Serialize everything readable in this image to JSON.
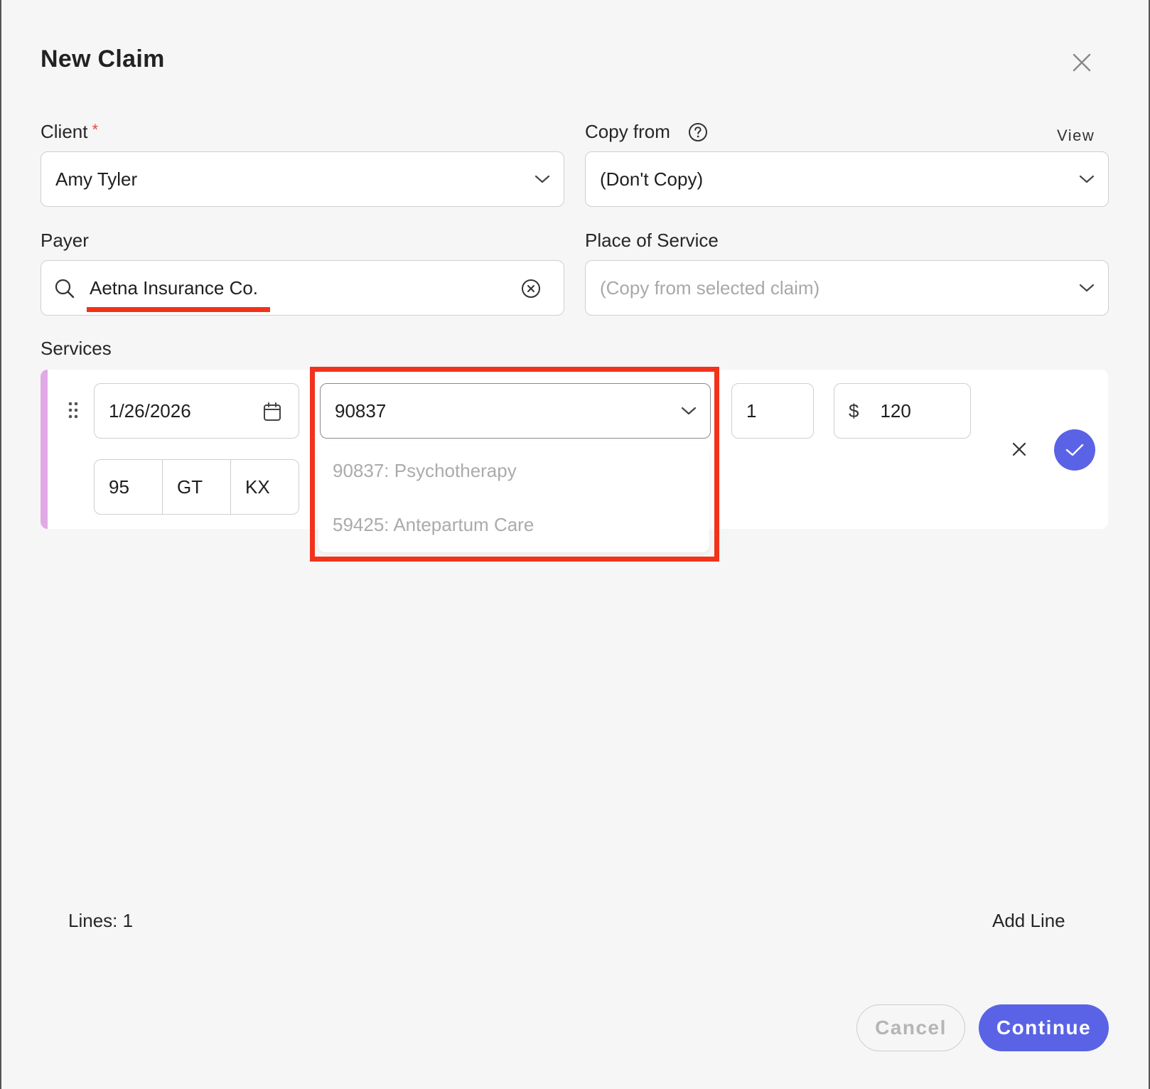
{
  "dialog": {
    "title": "New Claim"
  },
  "client": {
    "label": "Client",
    "required_marker": "*",
    "value": "Amy Tyler"
  },
  "copy_from": {
    "label": "Copy from",
    "view_link": "View",
    "value": "(Don't Copy)"
  },
  "payer": {
    "label": "Payer",
    "value": "Aetna Insurance Co."
  },
  "place_of_service": {
    "label": "Place of Service",
    "placeholder": "(Copy from selected claim)"
  },
  "services": {
    "label": "Services",
    "line": {
      "date": "1/26/2026",
      "procedure_code": "90837",
      "units": "1",
      "currency_symbol": "$",
      "charge": "120",
      "modifiers": [
        "95",
        "GT",
        "KX"
      ]
    },
    "procedure_options": [
      "90837: Psychotherapy",
      "59425: Antepartum Care"
    ]
  },
  "footer": {
    "lines_label": "Lines: 1",
    "add_line": "Add Line",
    "cancel": "Cancel",
    "continue": "Continue"
  },
  "colors": {
    "accent": "#5a63e6",
    "highlight": "#f2321c",
    "service_accent_bar": "#e1a9e6",
    "background": "#f6f6f6"
  },
  "icons": {
    "close": "close-icon",
    "help": "question-circle-icon",
    "chevron": "chevron-down-icon",
    "search": "search-icon",
    "clear": "clear-circle-icon",
    "calendar": "calendar-icon",
    "drag": "drag-handle-icon",
    "confirm": "check-icon"
  }
}
